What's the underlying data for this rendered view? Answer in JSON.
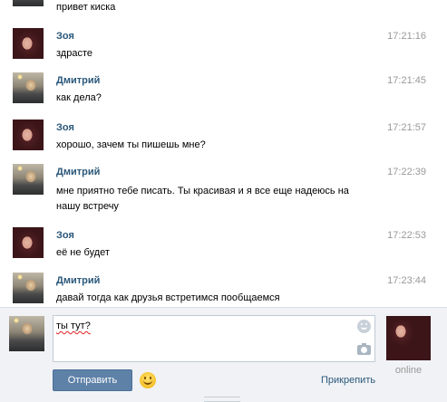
{
  "messages": [
    {
      "author": "",
      "avatar": "dmitry",
      "time": "",
      "text": "привет киска"
    },
    {
      "author": "Зоя",
      "avatar": "zoya",
      "time": "17:21:16",
      "text": "здрасте"
    },
    {
      "author": "Дмитрий",
      "avatar": "dmitry",
      "time": "17:21:45",
      "text": "как дела?"
    },
    {
      "author": "Зоя",
      "avatar": "zoya",
      "time": "17:21:57",
      "text": "хорошо, зачем ты пишешь мне?"
    },
    {
      "author": "Дмитрий",
      "avatar": "dmitry",
      "time": "17:22:39",
      "text": "мне приятно тебе писать. Ты красивая и я все еще надеюсь на нашу встречу"
    },
    {
      "author": "Зоя",
      "avatar": "zoya",
      "time": "17:22:53",
      "text": "её не будет"
    },
    {
      "author": "Дмитрий",
      "avatar": "dmitry",
      "time": "17:23:44",
      "text": "давай тогда как друзья встретимся пообщаемся"
    }
  ],
  "composer": {
    "input_value": "ты тут?",
    "send_label": "Отправить",
    "attach_label": "Прикрепить",
    "partner_status": "online",
    "icons": {
      "smile": "smile-icon",
      "camera": "camera-icon",
      "emoji": "emoji-icon"
    }
  },
  "colors": {
    "name_link": "#2b587a",
    "send_button": "#5e81a8",
    "timestamp": "#999999"
  }
}
